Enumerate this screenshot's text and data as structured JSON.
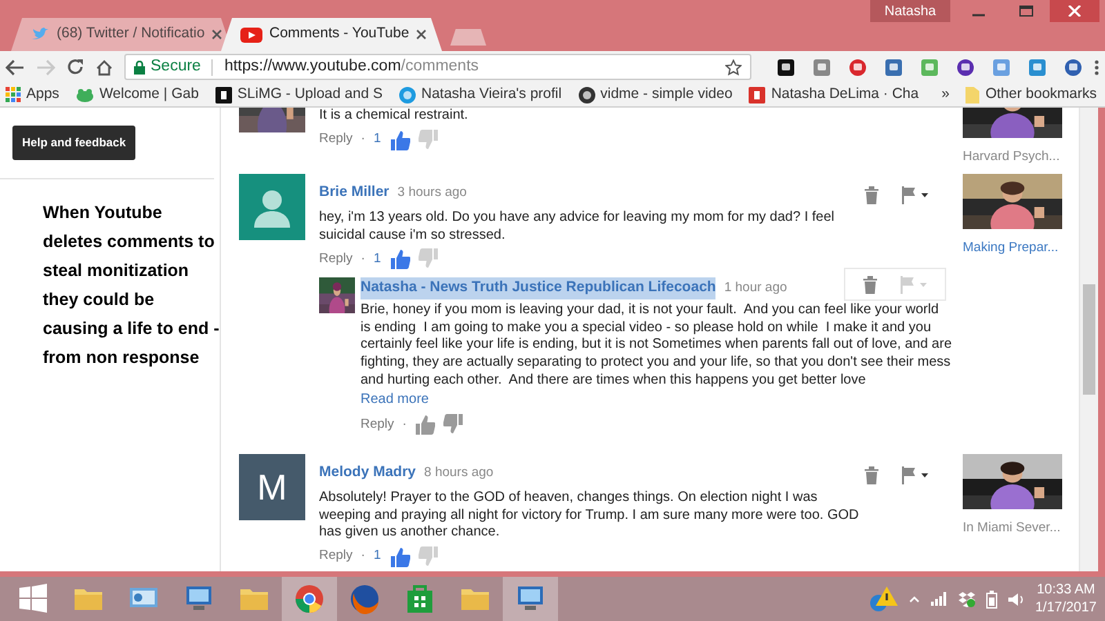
{
  "browser": {
    "tabs": [
      {
        "title": "(68) Twitter / Notificatio",
        "kind": "bird",
        "selected": false
      },
      {
        "title": "Comments - YouTube",
        "kind": "play",
        "selected": true
      }
    ],
    "profile": "Natasha",
    "address": {
      "secure": true,
      "secure_label": "Secure",
      "origin": "https://www.youtube.com",
      "path": "/comments"
    },
    "bookmarks": [
      {
        "label": "Apps",
        "kind": "grid",
        "color": "#e84335"
      },
      {
        "label": "Welcome | Gab",
        "kind": "blob",
        "color": "#3fae5a"
      },
      {
        "label": "SLiMG - Upload and S",
        "kind": "square",
        "color": "#111111"
      },
      {
        "label": "Natasha Vieira's profil",
        "kind": "circle",
        "color": "#1e9be0"
      },
      {
        "label": "vidme - simple video",
        "kind": "circle",
        "color": "#333333"
      },
      {
        "label": "Natasha DeLima · Cha",
        "kind": "square",
        "color": "#d9322b"
      }
    ],
    "more": "»",
    "other_bookmarks": "Other bookmarks"
  },
  "sidebar": {
    "help_button": "Help and feedback"
  },
  "annotation": "When Youtube deletes comments to steal monitization they could be causing a life to end - from non response",
  "comments": [
    {
      "text": "It is a chemical restraint.",
      "reply_label": "Reply",
      "separator": "·",
      "likes": "1",
      "liked": true,
      "video": {
        "title": "Harvard Psych...",
        "color": "#888888"
      }
    },
    {
      "avatar": {
        "kind": "silhouette",
        "color": "#16907e"
      },
      "author": "Brie Miller",
      "time": "3 hours ago",
      "text": "hey, i'm 13 years old. Do you have any advice for leaving my mom for my dad? I feel suicidal cause i'm so stressed.",
      "reply_label": "Reply",
      "separator": "·",
      "likes": "1",
      "liked": true,
      "actions": {
        "hovered": false
      },
      "video": {
        "title": "Making Prepar...",
        "color": "#3b78c2"
      },
      "replies": [
        {
          "author": "Natasha - News Truth Justice Republican Lifecoach",
          "author_selected": true,
          "time": "1 hour ago",
          "text": "Brie, honey if you mom is leaving your dad, it is not your fault.  And you can feel like your world is ending  I am going to make you a special video - so please hold on while  I make it and you certainly feel like your life is ending, but it is not Sometimes when parents fall out of love, and are fighting, they are actually separating to protect you and your life, so that you don't see their mess and hurting each other.  And there are times when this happens you get better love",
          "read_more": "Read more",
          "reply_label": "Reply",
          "separator": "·",
          "liked": false,
          "actions": {
            "hovered": true
          }
        }
      ]
    },
    {
      "avatar": {
        "kind": "letter",
        "letter": "M",
        "color": "#455a6b"
      },
      "author": "Melody Madry",
      "time": "8 hours ago",
      "text": "Absolutely! Prayer to the GOD of heaven, changes things. On election night I was weeping and praying all night for victory for Trump. I am sure many more were too. GOD has given us another chance.",
      "reply_label": "Reply",
      "separator": "·",
      "likes": "1",
      "liked": true,
      "actions": {
        "hovered": false
      },
      "video": {
        "title": "In Miami Sever...",
        "color": "#888888"
      }
    }
  ],
  "taskbar": {
    "apps": [
      {
        "kind": "windows",
        "active": false
      },
      {
        "kind": "folder",
        "active": false
      },
      {
        "kind": "panel",
        "active": false
      },
      {
        "kind": "computer",
        "active": false
      },
      {
        "kind": "folder",
        "active": false
      },
      {
        "kind": "chrome",
        "active": true
      },
      {
        "kind": "fox",
        "active": false
      },
      {
        "kind": "bag",
        "active": false
      },
      {
        "kind": "folder",
        "active": false
      },
      {
        "kind": "computer",
        "active": true
      }
    ],
    "time": "10:33 AM",
    "date": "1/17/2017"
  }
}
